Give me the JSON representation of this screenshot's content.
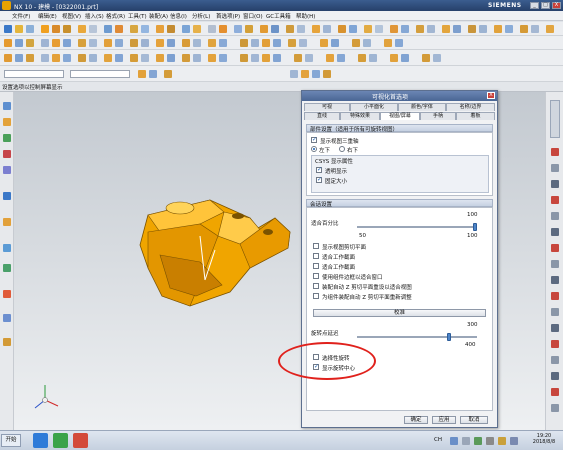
{
  "window": {
    "title": "NX 10 - 建模 - [0322001.prt]",
    "brand": "SIEMENS",
    "controls": [
      "_",
      "□",
      "X"
    ]
  },
  "menu": [
    "文件(F)",
    "编辑(E)",
    "视图(V)",
    "插入(S)",
    "格式(R)",
    "工具(T)",
    "装配(A)",
    "信息(I)",
    "分析(L)",
    "首选项(P)",
    "窗口(O)",
    "GC工具箱",
    "帮助(H)"
  ],
  "status_message": "设置选项以控制屏幕显示",
  "dialog": {
    "title": "可视化首选项",
    "close": "X",
    "tabs_row1": [
      "可视",
      "小平面化",
      "颜色/字体",
      "名称/边界"
    ],
    "tabs_row2": [
      "直线",
      "特殊效果",
      "视图/屏幕",
      "手柄",
      "着板"
    ],
    "selected_tab": "视图/屏幕",
    "section1": {
      "header": "部件设置（适用于所有可旋转视图）",
      "show_triad": "显示视图三重轴",
      "radio_left": "左下",
      "radio_right": "右下",
      "csys_header": "CSYS 显示属性",
      "csys_transparent": "透明显示",
      "csys_fixed_size": "固定大小"
    },
    "section2": {
      "header": "会话设置",
      "fit_pct_label": "适合百分比",
      "fit_pct_value": "100",
      "fit_min": "50",
      "fit_max": "100",
      "options": [
        {
          "label": "显示视图剪切平面",
          "checked": false
        },
        {
          "label": "适合工作截面",
          "checked": false
        },
        {
          "label": "适合工作截面",
          "checked": false
        },
        {
          "label": "使用组件边框以适合窗口",
          "checked": false
        },
        {
          "label": "装配自动 Z 剪切平面重设以适合视图",
          "checked": false
        },
        {
          "label": "为组件装配自动 Z 剪切平面重新调整",
          "checked": false
        }
      ],
      "calibrate_button": "校准",
      "rotation_delay_label": "旋转点延迟",
      "rotation_delay_value": "300",
      "rotation_delay_max": "400",
      "use_rotation_point": "选择性旋转",
      "show_rotation_center": "显示旋转中心",
      "show_rotation_center_checked": true
    },
    "buttons": {
      "ok": "确定",
      "apply": "应用",
      "cancel": "取消"
    }
  },
  "taskbar": {
    "start": "开始",
    "tray_lang": "CH",
    "clock_time": "19:20",
    "clock_date": "2018/8/8"
  },
  "annotation_color": "#e0211c",
  "part_color": "#f0a500"
}
